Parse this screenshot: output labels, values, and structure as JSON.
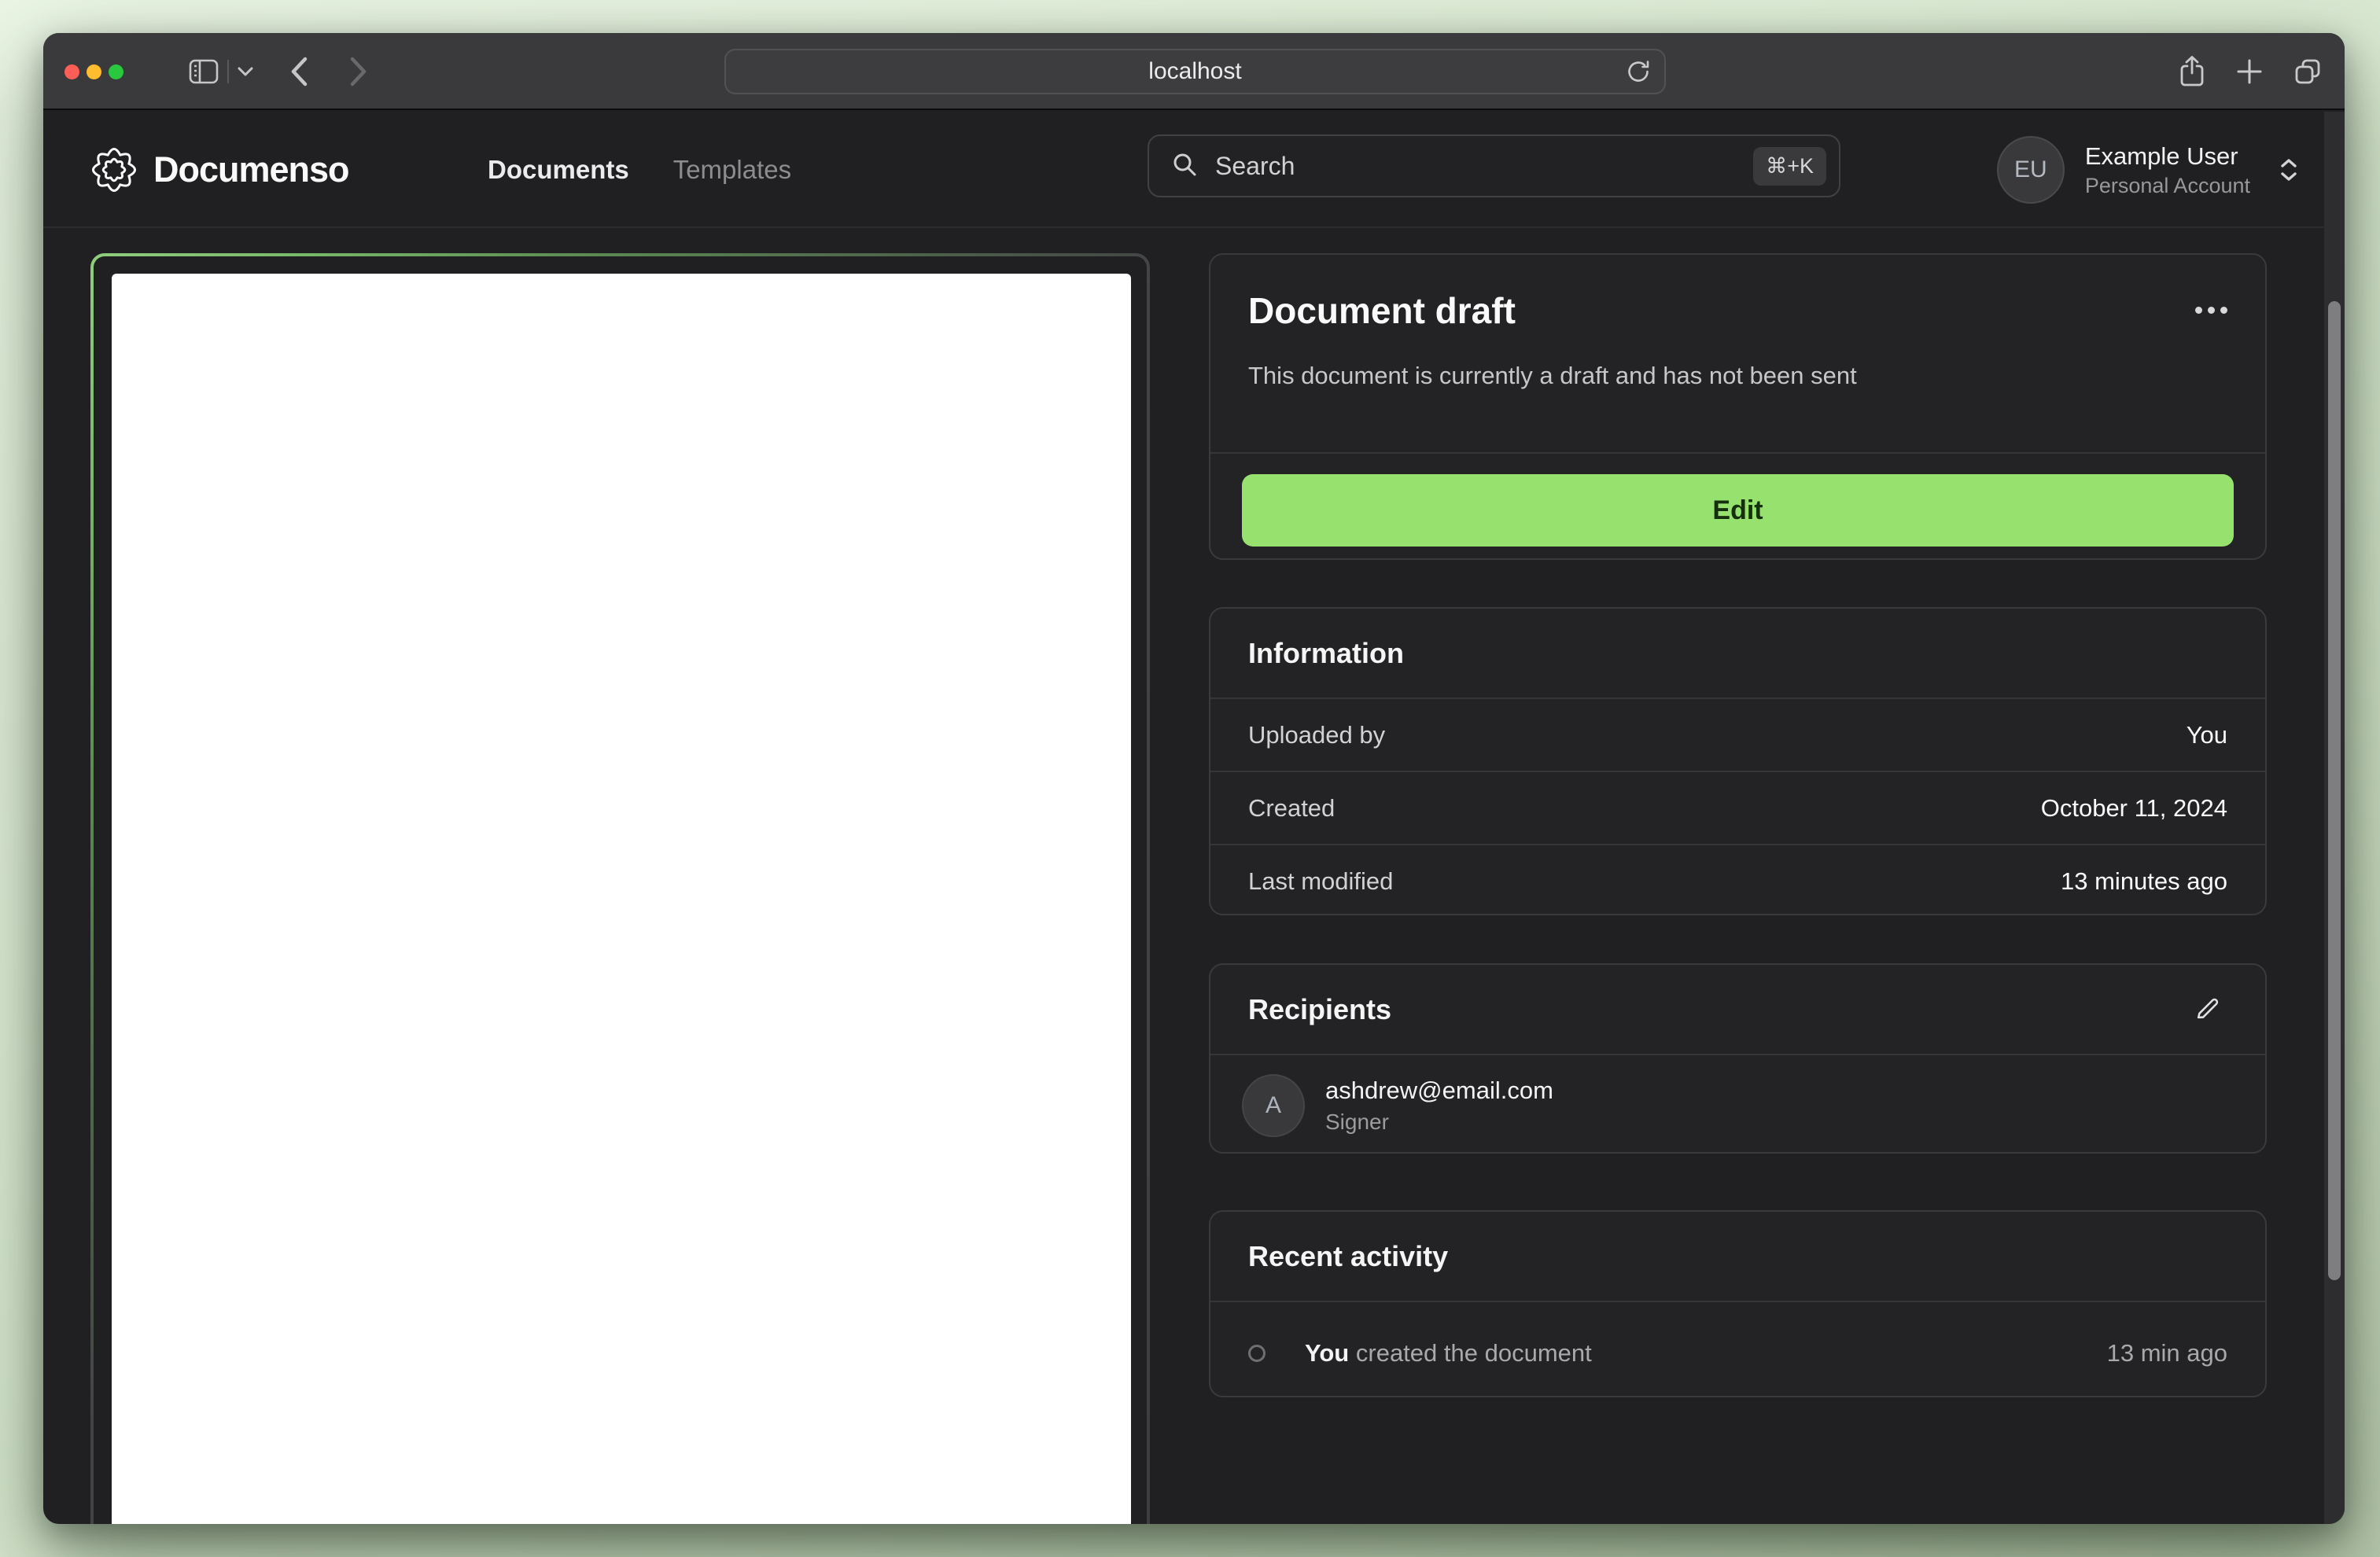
{
  "browser": {
    "url": "localhost"
  },
  "app_header": {
    "brand": "Documenso",
    "nav": [
      {
        "label": "Documents"
      },
      {
        "label": "Templates"
      }
    ],
    "search": {
      "placeholder": "Search",
      "shortcut": "⌘+K"
    },
    "user": {
      "initials": "EU",
      "name": "Example User",
      "account": "Personal Account"
    }
  },
  "document_card": {
    "title": "Document draft",
    "subtitle": "This document is currently a draft and has not been sent",
    "edit_label": "Edit"
  },
  "information_card": {
    "title": "Information",
    "rows": [
      {
        "label": "Uploaded by",
        "value": "You"
      },
      {
        "label": "Created",
        "value": "October 11, 2024"
      },
      {
        "label": "Last modified",
        "value": "13 minutes ago"
      }
    ]
  },
  "recipients_card": {
    "title": "Recipients",
    "recipients": [
      {
        "initials": "A",
        "email": "ashdrew@email.com",
        "role": "Signer"
      }
    ]
  },
  "activity_card": {
    "title": "Recent activity",
    "items": [
      {
        "actor": "You",
        "action": "created the document",
        "time": "13 min ago"
      }
    ]
  },
  "colors": {
    "accent_green": "#97e16e",
    "accent_text": "#15300d",
    "frame_green": "#8fce7d",
    "chrome_gray": "#3a3a3c",
    "app_background": "#202022",
    "desktop_mint": "#dfeed8"
  }
}
